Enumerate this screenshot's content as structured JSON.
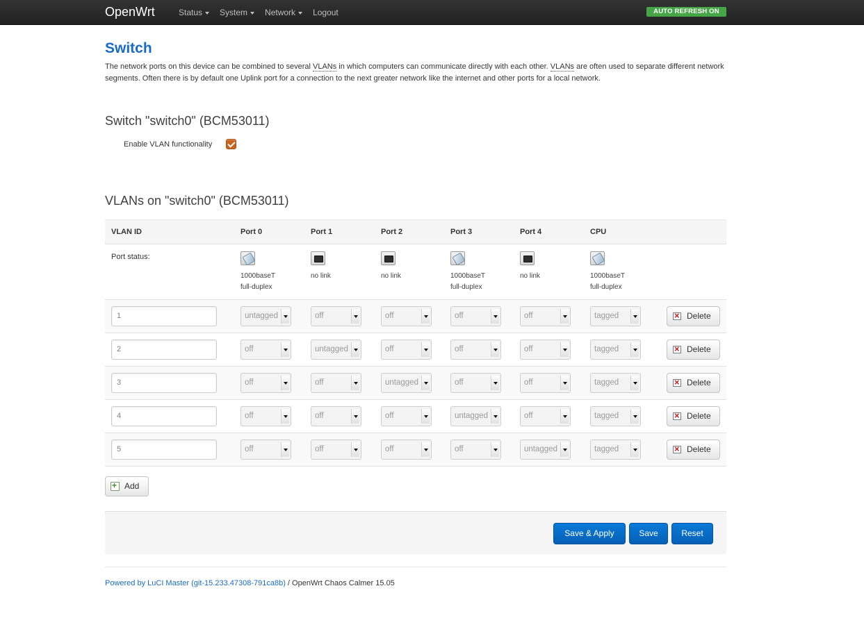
{
  "topbar": {
    "brand": "OpenWrt",
    "nav": [
      {
        "label": "Status",
        "dropdown": true
      },
      {
        "label": "System",
        "dropdown": true
      },
      {
        "label": "Network",
        "dropdown": true
      },
      {
        "label": "Logout",
        "dropdown": false
      }
    ],
    "refresh_badge": "AUTO REFRESH ON"
  },
  "page": {
    "title": "Switch",
    "description_parts": [
      "The network ports on this device can be combined to several ",
      "VLANs",
      " in which computers can communicate directly with each other. ",
      "VLANs",
      " are often used to separate different network segments. Often there is by default one Uplink port for a connection to the next greater network like the internet and other ports for a local network."
    ]
  },
  "switch_section": {
    "title": "Switch \"switch0\" (BCM53011)",
    "vlan_label": "Enable VLAN functionality",
    "vlan_enabled": true
  },
  "vlans_section": {
    "title": "VLANs on \"switch0\" (BCM53011)",
    "columns": [
      "VLAN ID",
      "Port 0",
      "Port 1",
      "Port 2",
      "Port 3",
      "Port 4",
      "CPU"
    ],
    "port_status_label": "Port status:",
    "port_status": [
      {
        "icon": "ethernet-linked-icon",
        "line1": "1000baseT",
        "line2": "full-duplex"
      },
      {
        "icon": "ethernet-nolink-icon",
        "line1": "no link",
        "line2": ""
      },
      {
        "icon": "ethernet-nolink-icon",
        "line1": "no link",
        "line2": ""
      },
      {
        "icon": "ethernet-linked-icon",
        "line1": "1000baseT",
        "line2": "full-duplex"
      },
      {
        "icon": "ethernet-nolink-icon",
        "line1": "no link",
        "line2": ""
      },
      {
        "icon": "ethernet-linked-icon",
        "line1": "1000baseT",
        "line2": "full-duplex"
      }
    ],
    "rows": [
      {
        "vid": "1",
        "ports": [
          "untagged",
          "off",
          "off",
          "off",
          "off",
          "tagged"
        ]
      },
      {
        "vid": "2",
        "ports": [
          "off",
          "untagged",
          "off",
          "off",
          "off",
          "tagged"
        ]
      },
      {
        "vid": "3",
        "ports": [
          "off",
          "off",
          "untagged",
          "off",
          "off",
          "tagged"
        ]
      },
      {
        "vid": "4",
        "ports": [
          "off",
          "off",
          "off",
          "untagged",
          "off",
          "tagged"
        ]
      },
      {
        "vid": "5",
        "ports": [
          "off",
          "off",
          "off",
          "off",
          "untagged",
          "tagged"
        ]
      }
    ],
    "delete_label": "Delete",
    "add_label": "Add"
  },
  "actions": {
    "save_apply": "Save & Apply",
    "save": "Save",
    "reset": "Reset"
  },
  "footer": {
    "link_text": "Powered by LuCI Master (git-15.233.47308-791ca8b)",
    "separator": " / ",
    "version": "OpenWrt Chaos Calmer 15.05"
  },
  "colors": {
    "brand_blue": "#1a6bc6",
    "badge_green": "#46a546",
    "checkbox_orange": "#c7651e",
    "primary_button": "#0560b6"
  }
}
